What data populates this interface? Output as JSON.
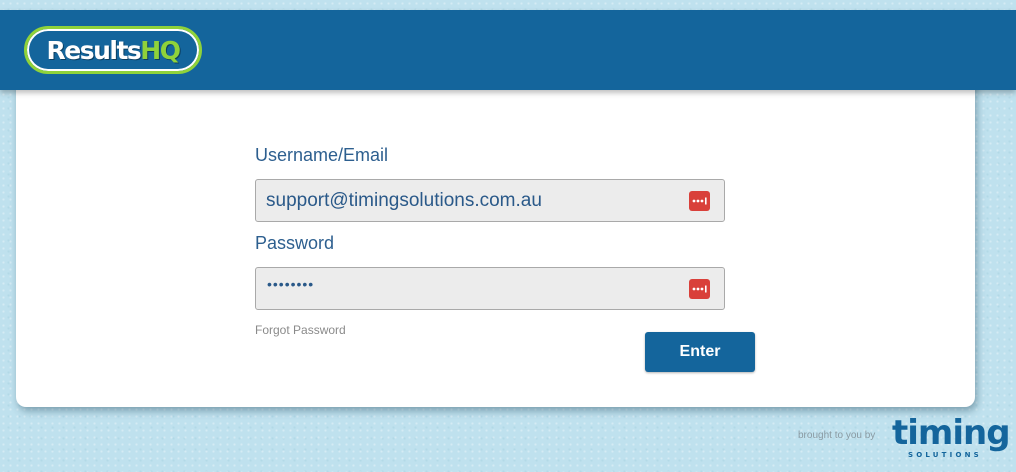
{
  "header": {
    "logo_primary": "Results",
    "logo_secondary": "HQ"
  },
  "login_form": {
    "username_label": "Username/Email",
    "username_value": "support@timingsolutions.com.au",
    "password_label": "Password",
    "password_value": "••••••••",
    "forgot_password": "Forgot Password",
    "enter_button": "Enter"
  },
  "footer": {
    "brought_to_you": "brought to you by",
    "brand_main": "timing",
    "brand_sub": "SOLUTIONS"
  },
  "colors": {
    "header_blue": "#14659c",
    "logo_green": "#8fd23a",
    "background": "#bfe1ee",
    "password_manager_red": "#d9403a"
  },
  "icons": {
    "password_manager": "password-manager-icon"
  }
}
